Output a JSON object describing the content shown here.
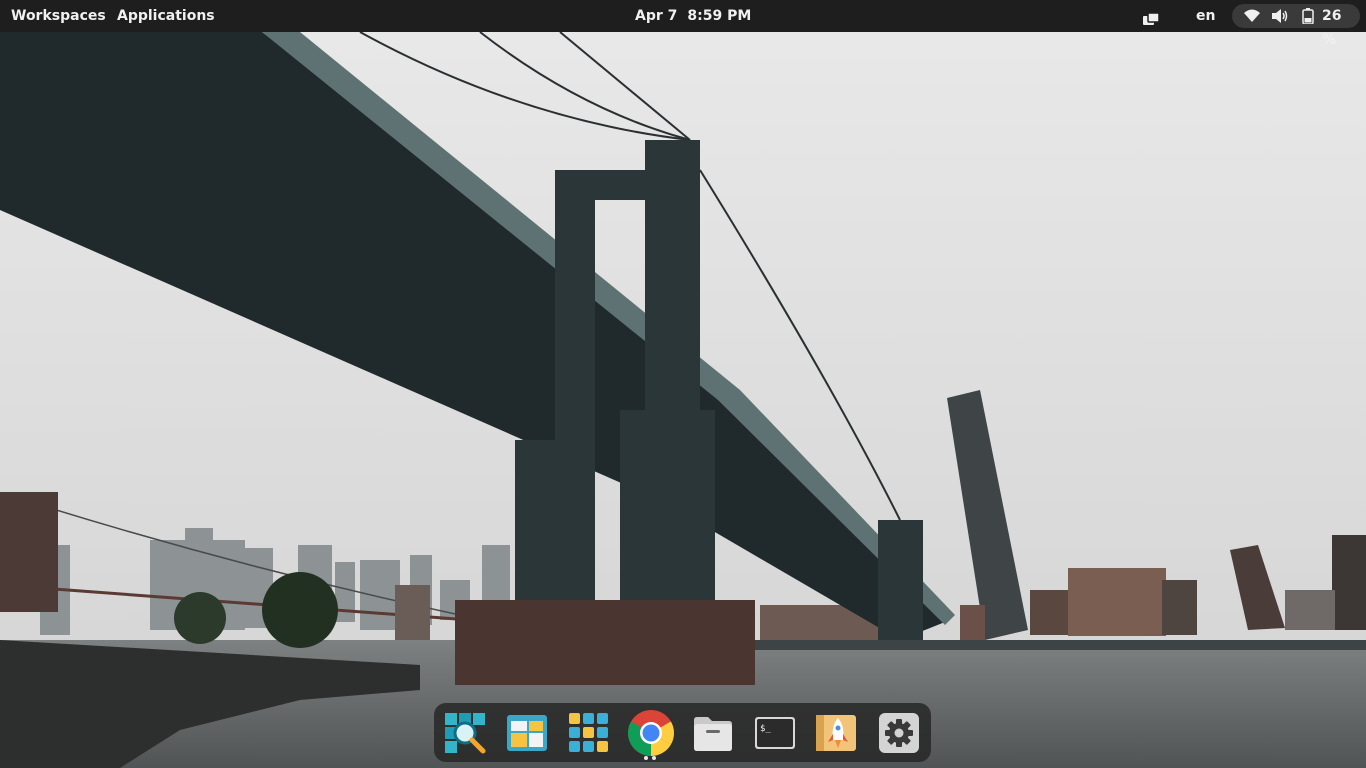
{
  "topbar": {
    "workspaces_label": "Workspaces",
    "applications_label": "Applications",
    "clock": {
      "date": "Apr 7",
      "time": "8:59 PM"
    },
    "language": "en",
    "battery_percent": "26 %",
    "icons": [
      "windows-icon",
      "wifi-icon",
      "volume-icon",
      "battery-icon"
    ]
  },
  "dock": {
    "items": [
      {
        "name": "search-magnifier-app",
        "icon": "magnifier-icon"
      },
      {
        "name": "window-tiling-app",
        "icon": "tiling-icon"
      },
      {
        "name": "app-grid",
        "icon": "grid-icon"
      },
      {
        "name": "chrome",
        "icon": "chrome-icon",
        "running": true
      },
      {
        "name": "files",
        "icon": "folder-icon"
      },
      {
        "name": "terminal",
        "icon": "terminal-icon",
        "text": "$_"
      },
      {
        "name": "launcher",
        "icon": "rocket-icon"
      },
      {
        "name": "settings",
        "icon": "gear-icon"
      }
    ]
  },
  "wallpaper": {
    "subject": "bridge-over-river-skyline"
  },
  "colors": {
    "topbar_bg": "#1e1e1e",
    "status_pill_bg": "#3a3a3a",
    "dock_bg": "#282828",
    "sky": "#dedede",
    "bridge": "#1f2a2c"
  }
}
